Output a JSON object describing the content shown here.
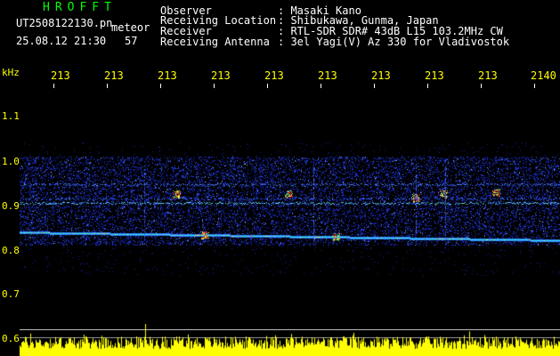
{
  "header": {
    "station": "HROFFT",
    "filename": "UT2508122130.pn",
    "meteor_label": "meteor",
    "datetime": "25.08.12 21:30",
    "count": "57"
  },
  "info": {
    "observer_label": "Observer",
    "observer_value": ": Masaki Kano",
    "location_label": "Receiving Location",
    "location_value": ": Shibukawa, Gunma, Japan",
    "receiver_label": "Receiver",
    "receiver_value": ": RTL-SDR SDR# 43dB L15 103.2MHz CW",
    "antenna_label": "Receiving Antenna",
    "antenna_value": ": 3el Yagi(V) Az 330 for Vladivostok"
  },
  "axes": {
    "y_unit": "kHz",
    "y_ticks": [
      "1.1",
      "1.0",
      "0.9",
      "0.8",
      "0.7",
      "0.6"
    ],
    "x_ticks": [
      "213",
      "213",
      "213",
      "213",
      "213",
      "213",
      "213",
      "213",
      "213",
      "2140"
    ]
  },
  "colors": {
    "background": "#000000",
    "text": "#ffffff",
    "axis_text": "#ffff00",
    "station": "#00ff00",
    "noise": "#1e3cff",
    "meter": "#ffff00"
  }
}
